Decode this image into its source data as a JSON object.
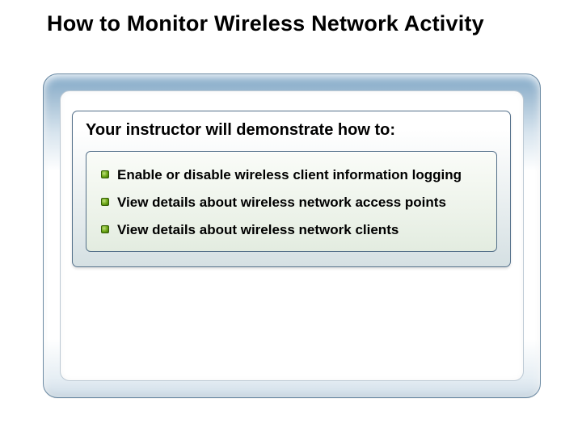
{
  "title": "How to Monitor Wireless Network Activity",
  "card": {
    "heading": "Your instructor will demonstrate how to:",
    "bullets": [
      "Enable or disable wireless client information logging",
      "View details about wireless network access points",
      "View details about wireless network clients"
    ]
  }
}
